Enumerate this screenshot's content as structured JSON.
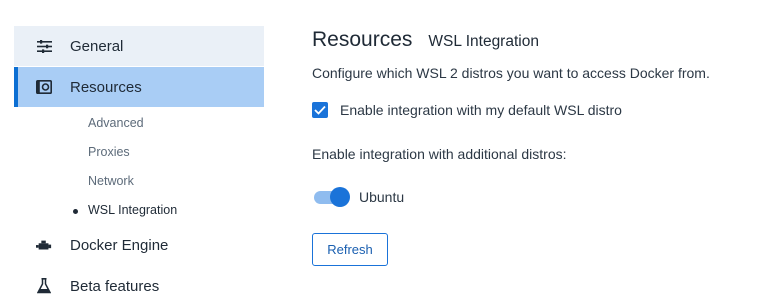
{
  "sidebar": {
    "items": [
      {
        "label": "General",
        "icon": "sliders-icon"
      },
      {
        "label": "Resources",
        "icon": "resources-icon",
        "selected": true
      },
      {
        "label": "Docker Engine",
        "icon": "engine-icon"
      },
      {
        "label": "Beta features",
        "icon": "flask-icon"
      }
    ],
    "sub_items": [
      {
        "label": "Advanced"
      },
      {
        "label": "Proxies"
      },
      {
        "label": "Network"
      },
      {
        "label": "WSL Integration",
        "selected": true
      }
    ]
  },
  "main": {
    "title": "Resources",
    "subtitle": "WSL Integration",
    "description": "Configure which WSL 2 distros you want to access Docker from.",
    "default_distro": {
      "label": "Enable integration with my default WSL distro",
      "checked": true
    },
    "additional_label": "Enable integration with additional distros:",
    "distros": [
      {
        "label": "Ubuntu",
        "enabled": true
      }
    ],
    "refresh_label": "Refresh"
  },
  "colors": {
    "accent": "#1a73d9",
    "selected_bg": "#a9cdf5",
    "hover_bg": "#eaf0f7"
  }
}
